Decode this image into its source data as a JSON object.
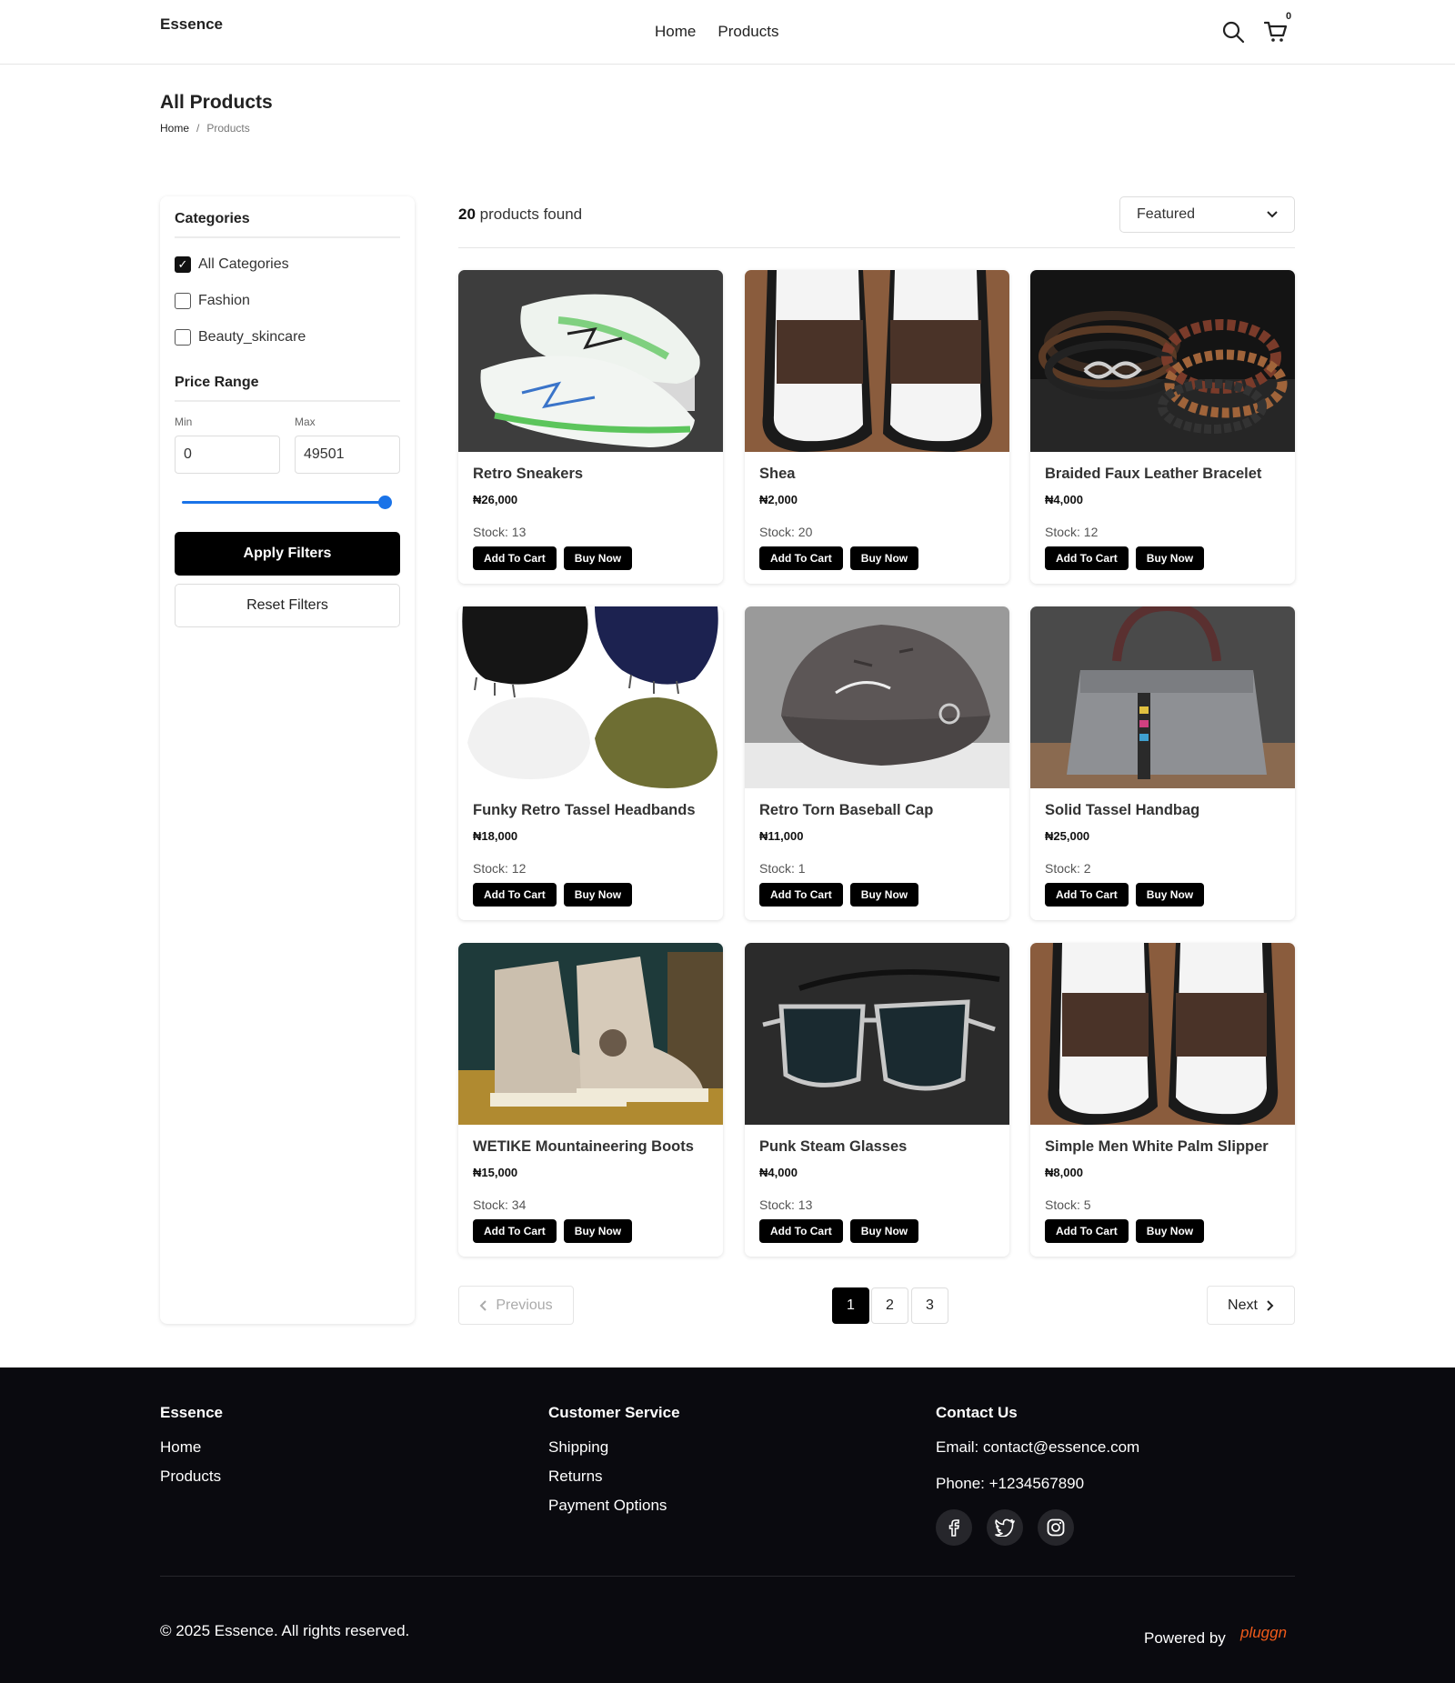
{
  "header": {
    "logo": "Essence",
    "nav": [
      "Home",
      "Products"
    ],
    "cart_count": "0"
  },
  "page": {
    "title": "All Products",
    "breadcrumb": [
      "Home",
      "/",
      "Products"
    ]
  },
  "filters": {
    "categories_heading": "Categories",
    "categories": [
      {
        "label": "All Categories",
        "checked": true
      },
      {
        "label": "Fashion",
        "checked": false
      },
      {
        "label": "Beauty_skincare",
        "checked": false
      }
    ],
    "price_heading": "Price Range",
    "min_label": "Min",
    "max_label": "Max",
    "min_value": "0",
    "max_value": "49501",
    "slider_fraction": 1.0,
    "apply_label": "Apply Filters",
    "reset_label": "Reset Filters"
  },
  "results": {
    "count": "20",
    "count_suffix": "products found",
    "sort_selected": "Featured"
  },
  "products": [
    {
      "name": "Retro Sneakers",
      "price": "₦26,000",
      "stock": "Stock: 13",
      "add_label": "Add To Cart",
      "buy_label": "Buy Now",
      "image": "sneakers"
    },
    {
      "name": "Shea",
      "price": "₦2,000",
      "stock": "Stock: 20",
      "add_label": "Add To Cart",
      "buy_label": "Buy Now",
      "image": "slippers"
    },
    {
      "name": "Braided Faux Leather Bracelet",
      "price": "₦4,000",
      "stock": "Stock: 12",
      "add_label": "Add To Cart",
      "buy_label": "Buy Now",
      "image": "bracelet"
    },
    {
      "name": "Funky Retro Tassel Headbands",
      "price": "₦18,000",
      "stock": "Stock: 12",
      "add_label": "Add To Cart",
      "buy_label": "Buy Now",
      "image": "headbands"
    },
    {
      "name": "Retro Torn Baseball Cap",
      "price": "₦11,000",
      "stock": "Stock: 1",
      "add_label": "Add To Cart",
      "buy_label": "Buy Now",
      "image": "cap"
    },
    {
      "name": "Solid Tassel Handbag",
      "price": "₦25,000",
      "stock": "Stock: 2",
      "add_label": "Add To Cart",
      "buy_label": "Buy Now",
      "image": "handbag"
    },
    {
      "name": "WETIKE Mountaineering Boots",
      "price": "₦15,000",
      "stock": "Stock: 34",
      "add_label": "Add To Cart",
      "buy_label": "Buy Now",
      "image": "boots"
    },
    {
      "name": "Punk Steam Glasses",
      "price": "₦4,000",
      "stock": "Stock: 13",
      "add_label": "Add To Cart",
      "buy_label": "Buy Now",
      "image": "glasses"
    },
    {
      "name": "Simple Men White Palm Slipper",
      "price": "₦8,000",
      "stock": "Stock: 5",
      "add_label": "Add To Cart",
      "buy_label": "Buy Now",
      "image": "slippers"
    }
  ],
  "pagination": {
    "prev_label": "Previous",
    "next_label": "Next",
    "pages": [
      "1",
      "2",
      "3"
    ],
    "active": "1"
  },
  "footer": {
    "brand_heading": "Essence",
    "brand_links": [
      "Home",
      "Products"
    ],
    "service_heading": "Customer Service",
    "service_links": [
      "Shipping",
      "Returns",
      "Payment Options"
    ],
    "contact_heading": "Contact Us",
    "email": "Email: contact@essence.com",
    "phone": "Phone: +1234567890",
    "social": [
      "facebook-icon",
      "twitter-icon",
      "instagram-icon"
    ],
    "copyright": "© 2025 Essence. All rights reserved.",
    "powered_by": "Powered by",
    "powered_brand": "pluggn"
  }
}
